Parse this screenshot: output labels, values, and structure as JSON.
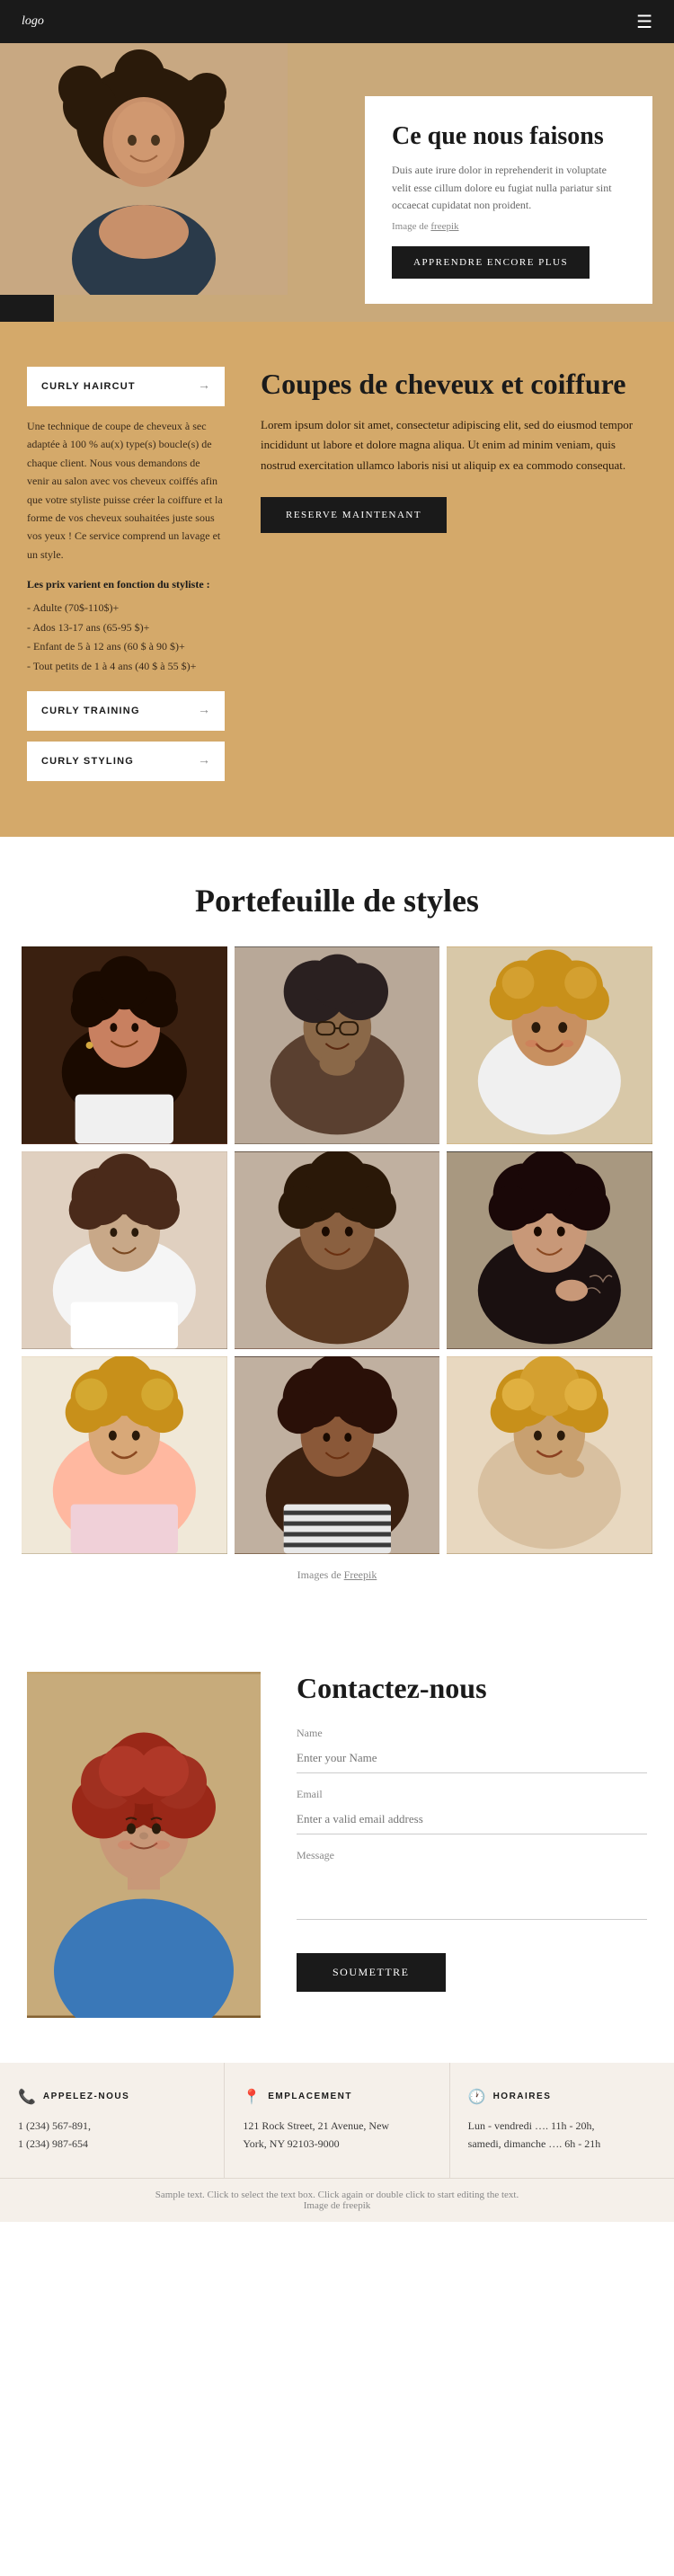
{
  "header": {
    "logo": "logo",
    "menu_icon": "☰"
  },
  "hero": {
    "title": "Ce que nous faisons",
    "description": "Duis aute irure dolor in reprehenderit in voluptate velit esse cillum dolore eu fugiat nulla pariatur sint occaecat cupidatat non proident.",
    "credit_prefix": "Image de",
    "credit_link": "freepik",
    "button_label": "APPRENDRE ENCORE PLUS"
  },
  "services": {
    "title": "Coupes de cheveux et coiffure",
    "description": "Lorem ipsum dolor sit amet, consectetur adipiscing elit, sed do eiusmod tempor incididunt ut labore et dolore magna aliqua. Ut enim ad minim veniam, quis nostrud exercitation ullamco laboris nisi ut aliquip ex ea commodo consequat.",
    "reserve_button": "RESERVE MAINTENANT",
    "items": [
      {
        "label": "CURLY HAIRCUT",
        "active": true,
        "description": "Une technique de coupe de cheveux à sec adaptée à 100 % au(x) type(s) boucle(s) de chaque client. Nous vous demandons de venir au salon avec vos cheveux coiffés afin que votre styliste puisse créer la coiffure et la forme de vos cheveux souhaitées juste sous vos yeux ! Ce service comprend un lavage et un style.",
        "prices_title": "Les prix varient en fonction du styliste :",
        "prices": [
          "- Adulte (70$-110$)+",
          "- Ados 13-17 ans (65-95 $)+",
          "- Enfant de 5 à 12 ans (60 $ à 90 $)+",
          "- Tout petits de 1 à 4 ans (40 $ à 55 $)+"
        ]
      },
      {
        "label": "CURLY TRAINING",
        "active": false
      },
      {
        "label": "CURLY STYLING",
        "active": false
      }
    ]
  },
  "portfolio": {
    "title": "Portefeuille de styles",
    "credit_prefix": "Images de",
    "credit_link": "Freepik",
    "images": [
      {
        "id": "p1",
        "alt": "Portrait 1"
      },
      {
        "id": "p2",
        "alt": "Portrait 2"
      },
      {
        "id": "p3",
        "alt": "Portrait 3"
      },
      {
        "id": "p4",
        "alt": "Portrait 4"
      },
      {
        "id": "p5",
        "alt": "Portrait 5"
      },
      {
        "id": "p6",
        "alt": "Portrait 6"
      },
      {
        "id": "p7",
        "alt": "Portrait 7"
      },
      {
        "id": "p8",
        "alt": "Portrait 8"
      },
      {
        "id": "p9",
        "alt": "Portrait 9"
      }
    ]
  },
  "contact": {
    "title": "Contactez-nous",
    "form": {
      "name_label": "Name",
      "name_placeholder": "Enter your Name",
      "email_label": "Email",
      "email_placeholder": "Enter a valid email address",
      "message_label": "Message",
      "submit_label": "SOUMETTRE"
    }
  },
  "info_blocks": [
    {
      "icon": "📞",
      "title": "APPELEZ-NOUS",
      "lines": [
        "1 (234) 567-891,",
        "1 (234) 987-654"
      ]
    },
    {
      "icon": "📍",
      "title": "EMPLACEMENT",
      "lines": [
        "121 Rock Street, 21 Avenue, New",
        "York, NY 92103-9000"
      ]
    },
    {
      "icon": "🕐",
      "title": "HORAIRES",
      "lines": [
        "Lun - vendredi …. 11h - 20h,",
        "samedi, dimanche …. 6h - 21h"
      ]
    }
  ],
  "bottom_note": {
    "text": "Sample text. Click to select the text box. Click again or double click to start editing the text."
  }
}
